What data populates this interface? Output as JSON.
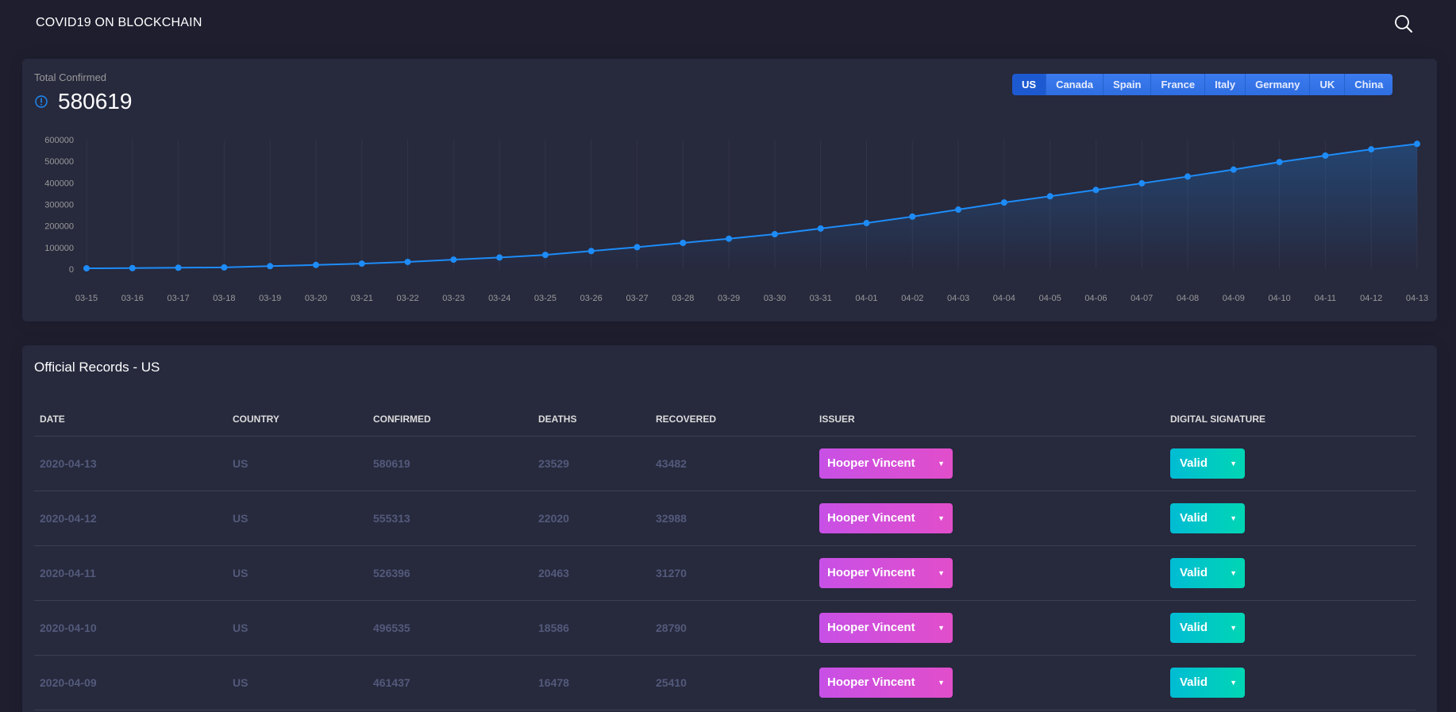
{
  "app": {
    "brand": "COVID19 ON BLOCKCHAIN",
    "search_icon": "search-icon"
  },
  "summary": {
    "category": "Total Confirmed",
    "value": "580619",
    "icon": "info-icon",
    "accent": "#1d8cf8"
  },
  "country_tabs": [
    {
      "label": "US",
      "active": true
    },
    {
      "label": "Canada",
      "active": false
    },
    {
      "label": "Spain",
      "active": false
    },
    {
      "label": "France",
      "active": false
    },
    {
      "label": "Italy",
      "active": false
    },
    {
      "label": "Germany",
      "active": false
    },
    {
      "label": "UK",
      "active": false
    },
    {
      "label": "China",
      "active": false
    }
  ],
  "chart_data": {
    "type": "line",
    "title": "",
    "xlabel": "",
    "ylabel": "",
    "ylim": [
      0,
      600000
    ],
    "yticks": [
      0,
      100000,
      200000,
      300000,
      400000,
      500000,
      600000
    ],
    "grid": "vertical",
    "color": "#1d8cf8",
    "x": [
      "03-15",
      "03-16",
      "03-17",
      "03-18",
      "03-19",
      "03-20",
      "03-21",
      "03-22",
      "03-23",
      "03-24",
      "03-25",
      "03-26",
      "03-27",
      "03-28",
      "03-29",
      "03-30",
      "03-31",
      "04-01",
      "04-02",
      "04-03",
      "04-04",
      "04-05",
      "04-06",
      "04-07",
      "04-08",
      "04-09",
      "04-10",
      "04-11",
      "04-12",
      "04-13"
    ],
    "series": [
      {
        "values": [
          3500,
          4600,
          6400,
          7800,
          13700,
          19100,
          25500,
          33300,
          43800,
          53700,
          65800,
          83800,
          101700,
          121500,
          140900,
          161800,
          188200,
          213400,
          243400,
          276000,
          308800,
          337600,
          367000,
          397800,
          429100,
          461400,
          496500,
          526400,
          555300,
          580619
        ]
      }
    ]
  },
  "records": {
    "title": "Official Records - US",
    "columns": [
      "DATE",
      "COUNTRY",
      "CONFIRMED",
      "DEATHS",
      "RECOVERED",
      "ISSUER",
      "DIGITAL SIGNATURE"
    ],
    "rows": [
      {
        "date": "2020-04-13",
        "country": "US",
        "confirmed": "580619",
        "deaths": "23529",
        "recovered": "43482",
        "issuer": "Hooper Vincent",
        "signature": "Valid"
      },
      {
        "date": "2020-04-12",
        "country": "US",
        "confirmed": "555313",
        "deaths": "22020",
        "recovered": "32988",
        "issuer": "Hooper Vincent",
        "signature": "Valid"
      },
      {
        "date": "2020-04-11",
        "country": "US",
        "confirmed": "526396",
        "deaths": "20463",
        "recovered": "31270",
        "issuer": "Hooper Vincent",
        "signature": "Valid"
      },
      {
        "date": "2020-04-10",
        "country": "US",
        "confirmed": "496535",
        "deaths": "18586",
        "recovered": "28790",
        "issuer": "Hooper Vincent",
        "signature": "Valid"
      },
      {
        "date": "2020-04-09",
        "country": "US",
        "confirmed": "461437",
        "deaths": "16478",
        "recovered": "25410",
        "issuer": "Hooper Vincent",
        "signature": "Valid"
      }
    ],
    "issuer_color": "#e14eca",
    "valid_color": "#00c3c9"
  }
}
